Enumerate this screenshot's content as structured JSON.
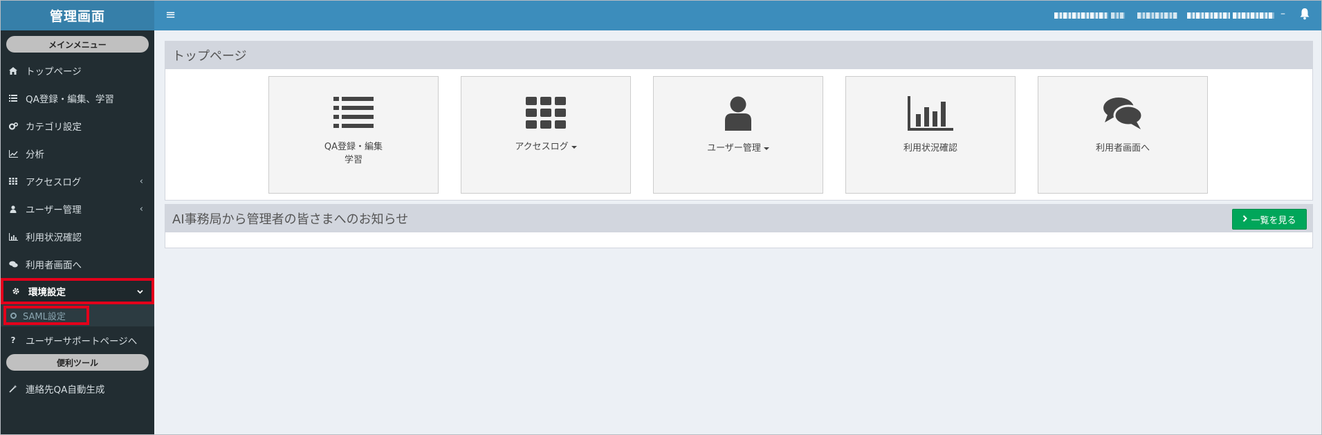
{
  "app": {
    "title": "管理画面"
  },
  "sidebar": {
    "main_header": "メインメニュー",
    "items": [
      {
        "label": "トップページ",
        "icon": "home-icon"
      },
      {
        "label": "QA登録・編集、学習",
        "icon": "list-icon"
      },
      {
        "label": "カテゴリ設定",
        "icon": "cogs-icon"
      },
      {
        "label": "分析",
        "icon": "line-chart-icon"
      },
      {
        "label": "アクセスログ",
        "icon": "grid-icon"
      },
      {
        "label": "ユーザー管理",
        "icon": "user-icon"
      },
      {
        "label": "利用状況確認",
        "icon": "bar-chart-icon"
      },
      {
        "label": "利用者画面へ",
        "icon": "comments-icon"
      },
      {
        "label": "環境設定",
        "icon": "gear-icon"
      },
      {
        "label": "ユーザーサポートページへ",
        "icon": "question-icon"
      }
    ],
    "sub_item": "SAML設定",
    "tools_header": "便利ツール",
    "tools_items": [
      {
        "label": "連絡先QA自動生成",
        "icon": "magic-wand-icon"
      }
    ]
  },
  "topbar": {
    "hamburger": "≡",
    "user_suffix": "–"
  },
  "top_page": {
    "title": "トップページ",
    "tiles": [
      {
        "label": "QA登録・編集\n学習"
      },
      {
        "label": "アクセスログ"
      },
      {
        "label": "ユーザー管理"
      },
      {
        "label": "利用状況確認"
      },
      {
        "label": "利用者画面へ"
      }
    ]
  },
  "notice": {
    "title": "AI事務局から管理者の皆さまへのお知らせ",
    "button": "一覧を見る"
  },
  "colors": {
    "sidebar_bg": "#222d32",
    "topbar_bg": "#3c8dbc",
    "logo_bg": "#367fa9",
    "highlight": "#e3001b",
    "button_green": "#00a65a"
  }
}
